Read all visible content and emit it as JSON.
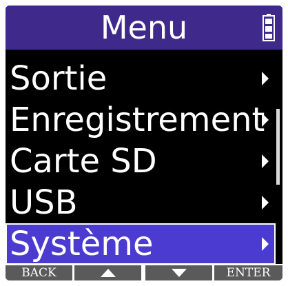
{
  "header": {
    "title": "Menu",
    "battery_icon": "battery-icon"
  },
  "menu": {
    "items": [
      {
        "label": "Sortie",
        "icon": "chevron-right-icon"
      },
      {
        "label": "Enregistrement",
        "icon": "chevron-right-icon"
      },
      {
        "label": "Carte SD",
        "icon": "chevron-right-icon"
      },
      {
        "label": "USB",
        "icon": "chevron-right-icon"
      },
      {
        "label": "Système",
        "icon": "chevron-right-icon",
        "selected": true
      }
    ]
  },
  "footer": {
    "back_label": "BACK",
    "up_icon": "arrow-up-icon",
    "down_icon": "arrow-down-icon",
    "enter_label": "ENTER"
  },
  "colors": {
    "header_bg": "#3f2a8c",
    "selected_bg": "#4b3bd0",
    "screen_bg": "#000000",
    "softkey_bg": "#5a5a5a"
  }
}
